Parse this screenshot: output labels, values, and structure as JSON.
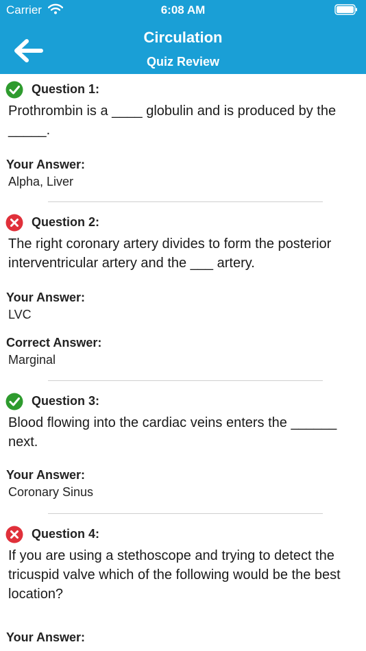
{
  "status_bar": {
    "carrier": "Carrier",
    "time": "6:08 AM"
  },
  "header": {
    "title": "Circulation",
    "subtitle": "Quiz Review",
    "bg_color": "#1a9fd6"
  },
  "labels": {
    "your_answer": "Your Answer:",
    "correct_answer": "Correct Answer:"
  },
  "questions": [
    {
      "label": "Question 1:",
      "status": "correct",
      "icon": "check-circle-icon",
      "text": "Prothrombin is a ____ globulin and is produced by the _____.",
      "your_answer": "Alpha, Liver"
    },
    {
      "label": "Question 2:",
      "status": "incorrect",
      "icon": "x-circle-icon",
      "text": "The right coronary artery divides to form the posterior interventricular artery and the ___ artery.",
      "your_answer": "LVC",
      "correct_answer": "Marginal"
    },
    {
      "label": "Question 3:",
      "status": "correct",
      "icon": "check-circle-icon",
      "text": "Blood flowing into the cardiac veins enters the ______ next.",
      "your_answer": "Coronary Sinus"
    },
    {
      "label": "Question 4:",
      "status": "incorrect",
      "icon": "x-circle-icon",
      "text": "If you are using a stethoscope and trying to detect the tricuspid valve which of the following would be the best location?",
      "your_answer": ""
    }
  ],
  "colors": {
    "correct": "#2e9b2e",
    "incorrect": "#e0303a",
    "divider": "#cfcfcf"
  }
}
